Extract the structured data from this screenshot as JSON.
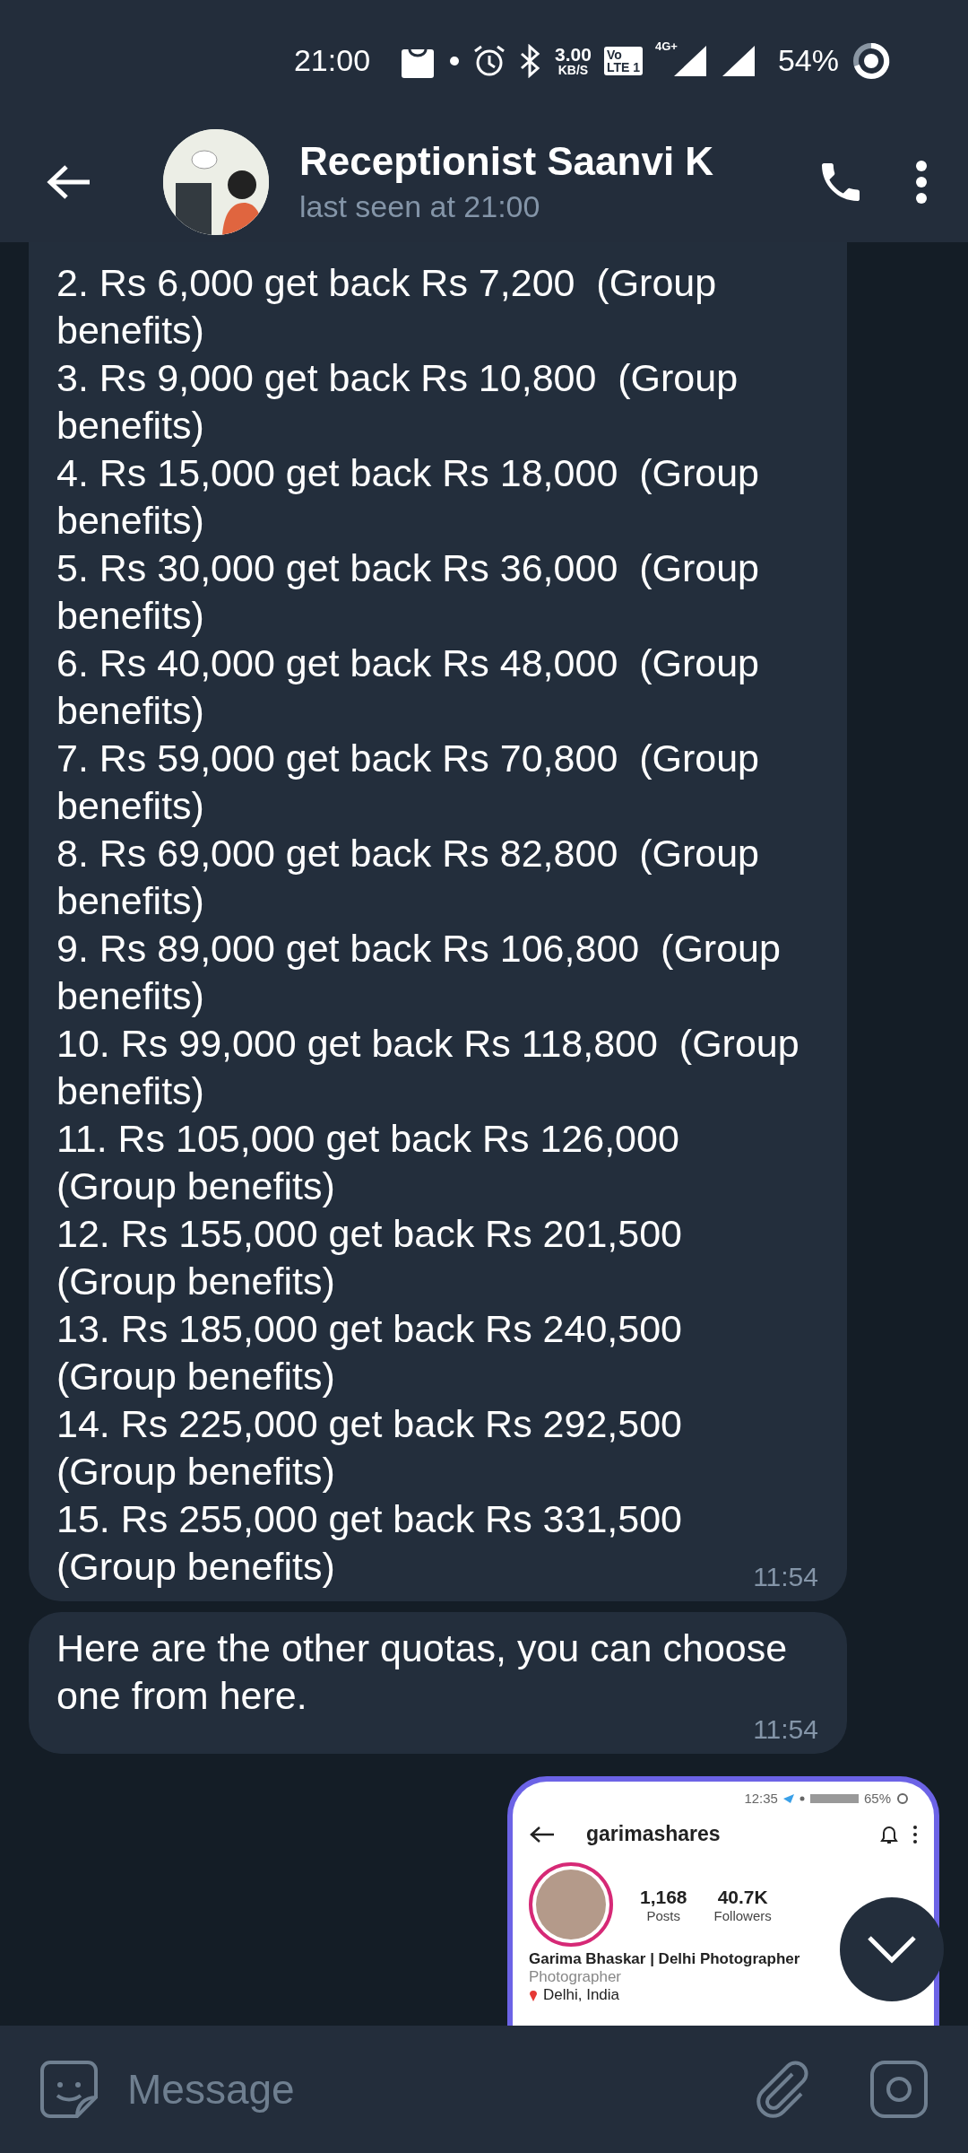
{
  "status_bar": {
    "time": "21:00",
    "speed_value": "3.00",
    "speed_unit": "KB/S",
    "volte_top": "Vo",
    "volte_bottom": "LTE 1",
    "network": "4G+",
    "battery": "54%"
  },
  "header": {
    "title": "Receptionist Saanvi K",
    "subtitle": "last seen at 21:00"
  },
  "messages": [
    {
      "kind": "list",
      "items": [
        "2. Rs 6,000 get back Rs 7,200  (Group benefits)",
        "3. Rs 9,000 get back Rs 10,800  (Group benefits)",
        "4. Rs 15,000 get back Rs 18,000  (Group benefits)",
        "5. Rs 30,000 get back Rs 36,000  (Group benefits)",
        "6. Rs 40,000 get back Rs 48,000  (Group benefits)",
        "7. Rs 59,000 get back Rs 70,800  (Group benefits)",
        "8. Rs 69,000 get back Rs 82,800  (Group benefits)",
        "9. Rs 89,000 get back Rs 106,800  (Group benefits)",
        "10. Rs 99,000 get back Rs 118,800  (Group benefits)",
        "11. Rs 105,000 get back Rs 126,000  (Group benefits)",
        "12. Rs 155,000 get back Rs 201,500  (Group benefits)",
        "13. Rs 185,000 get back Rs 240,500  (Group benefits)",
        "14. Rs 225,000 get back Rs 292,500  (Group benefits)",
        "15. Rs 255,000 get back Rs 331,500  (Group benefits)"
      ],
      "time": "11:54"
    },
    {
      "kind": "text",
      "text": "Here are the other quotas, you can choose one from here.",
      "time": "11:54"
    },
    {
      "kind": "image",
      "screenshot": {
        "time": "12:35",
        "battery": "65%",
        "username": "garimashares",
        "stats": [
          {
            "value": "1,168",
            "label": "Posts"
          },
          {
            "value": "40.7K",
            "label": "Followers"
          }
        ],
        "name": "Garima Bhaskar | Delhi Photographer",
        "category": "Photographer",
        "location": "Delhi, India"
      }
    }
  ],
  "composer": {
    "placeholder": "Message"
  }
}
